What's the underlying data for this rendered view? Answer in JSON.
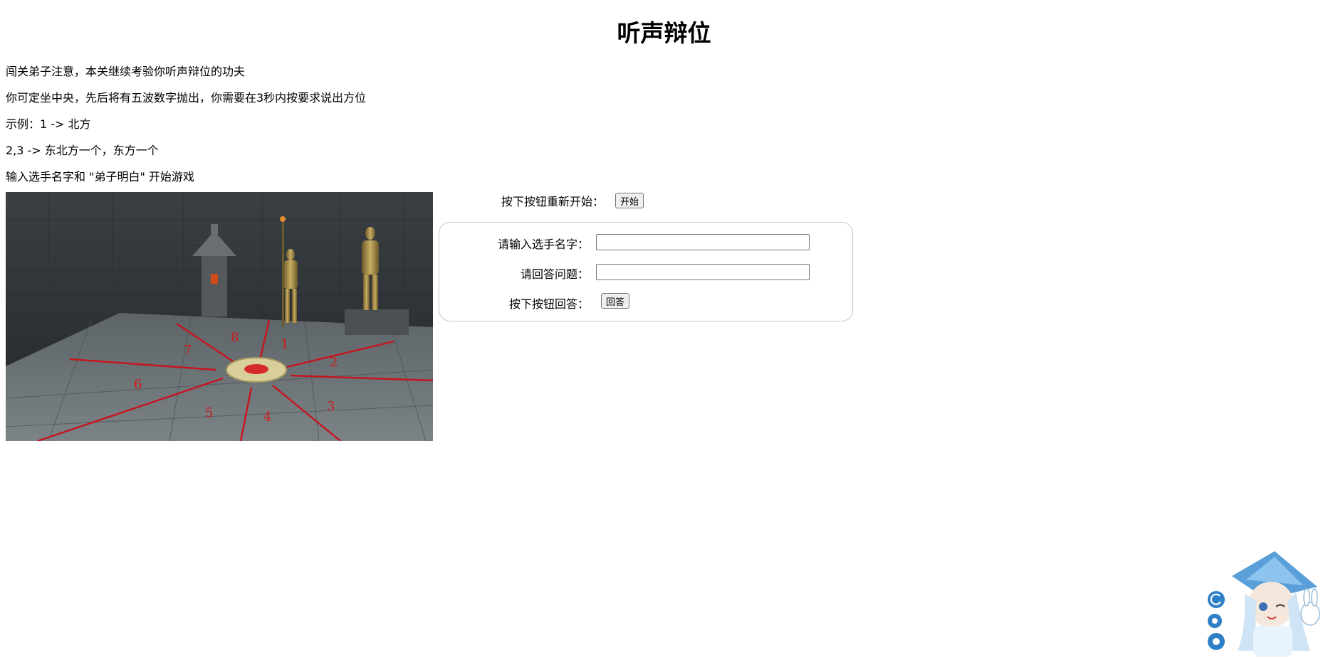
{
  "page": {
    "title": "听声辩位"
  },
  "intro": {
    "lines": [
      "闯关弟子注意，本关继续考验你听声辩位的功夫",
      "你可定坐中央，先后将有五波数字抛出，你需要在3秒内按要求说出方位",
      "示例：1 -> 北方",
      "2,3 -> 东北方一个，东方一个",
      "输入选手名字和 \"弟子明白\" 开始游戏"
    ]
  },
  "scene": {
    "direction_numbers": [
      "1",
      "2",
      "3",
      "4",
      "5",
      "6",
      "7",
      "8"
    ],
    "center_color": "#d42a2a",
    "line_color": "#c8141e"
  },
  "controls": {
    "restart_label": "按下按钮重新开始：",
    "start_button": "开始",
    "name_label": "请输入选手名字：",
    "name_value": "",
    "answer_label": "请回答问题：",
    "answer_value": "",
    "submit_label": "按下按钮回答：",
    "submit_button": "回答"
  },
  "widget": {
    "icons": [
      "refresh-icon",
      "settings-icon",
      "gear-icon"
    ],
    "accent": "#2f7fc6"
  }
}
